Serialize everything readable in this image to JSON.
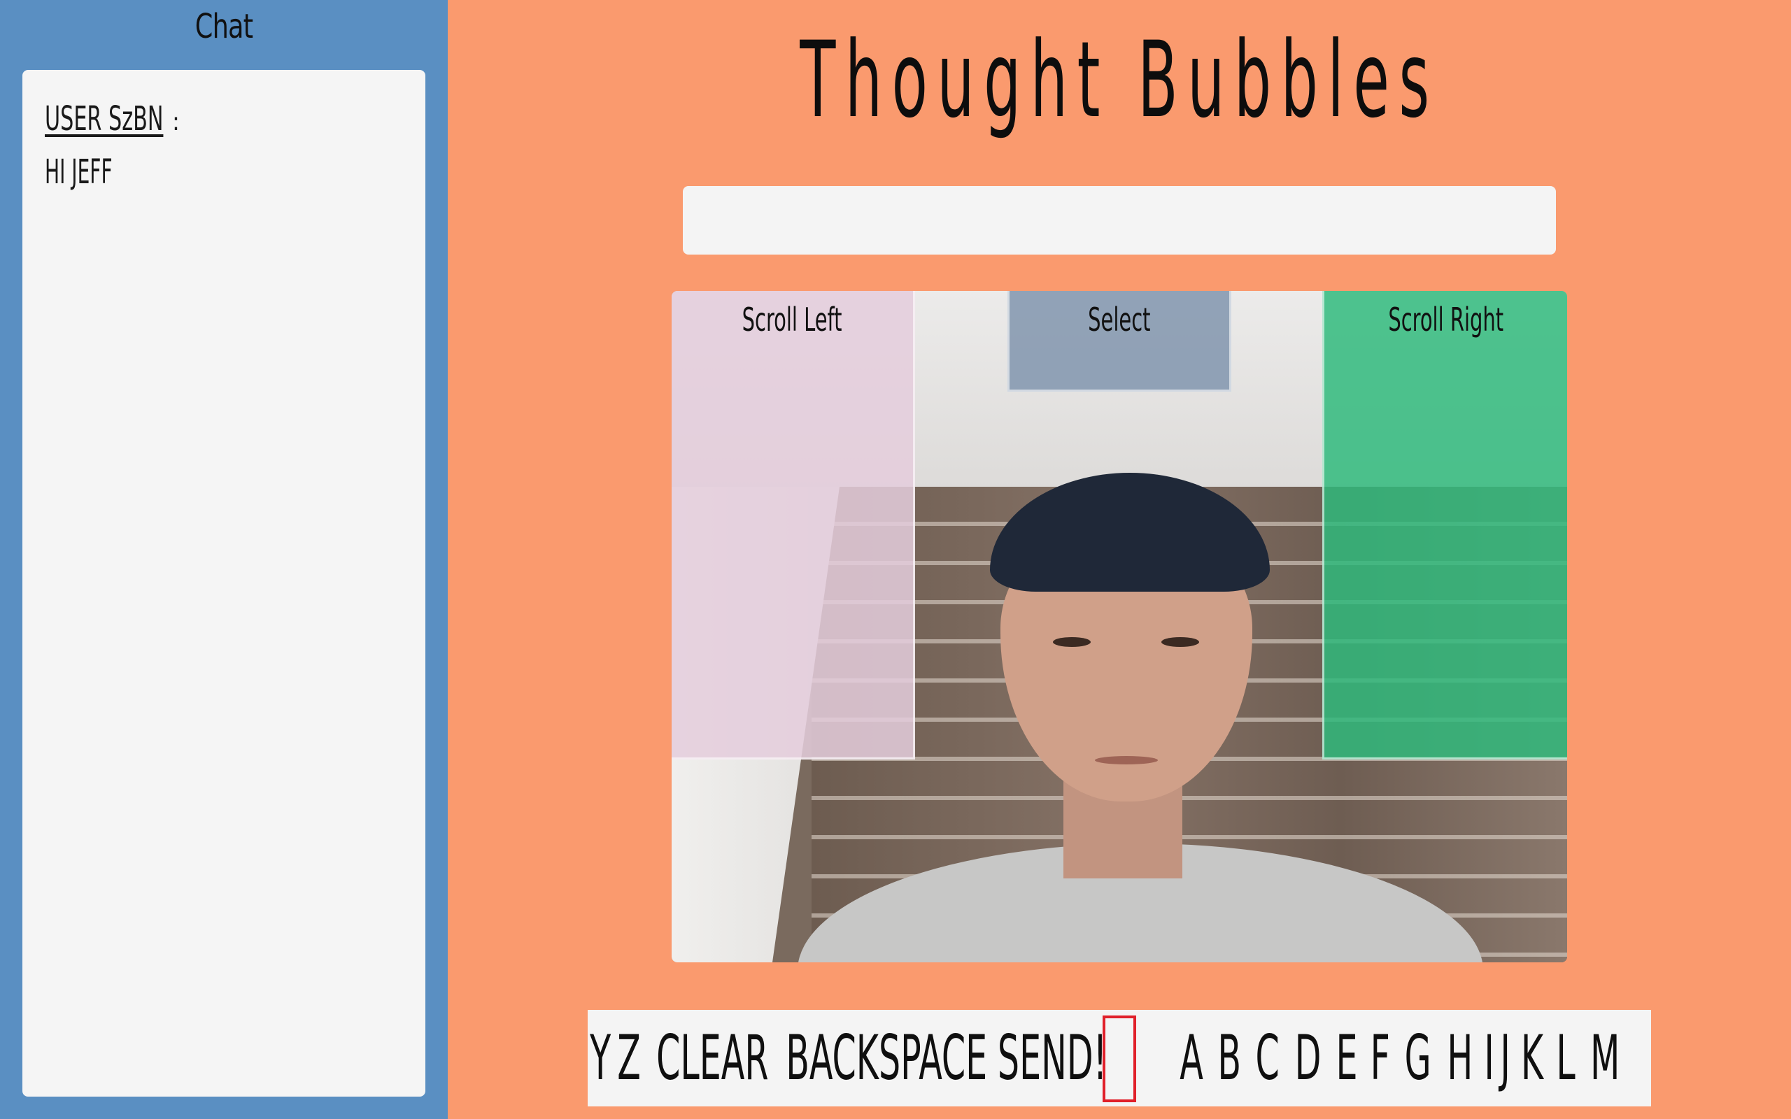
{
  "sidebar": {
    "title": "Chat",
    "messages": [
      {
        "user": "USER SzBN",
        "separator": ":",
        "text": "HI JEFF"
      }
    ]
  },
  "header": {
    "title": "Thought Bubbles"
  },
  "message_input": {
    "value": "",
    "placeholder": ""
  },
  "webcam": {
    "zones": {
      "scroll_left": "Scroll Left",
      "select": "Select",
      "scroll_right": "Scroll Right"
    }
  },
  "letter_bar": {
    "keys": [
      "Y",
      "Z",
      "CLEAR",
      "BACKSPACE",
      "SEND!",
      "",
      "A",
      "B",
      "C",
      "D",
      "E",
      "F",
      "G",
      "H",
      "I",
      "J",
      "K",
      "L",
      "M"
    ],
    "selected_index": 5
  },
  "colors": {
    "background": "#fa9a6e",
    "sidebar": "#5a8fc2",
    "panel": "#f5f5f5",
    "scroll_left_zone": "#e4cddc",
    "select_zone": "#899bb2",
    "scroll_right_zone": "#2eba7c",
    "cursor": "#e0202a"
  }
}
